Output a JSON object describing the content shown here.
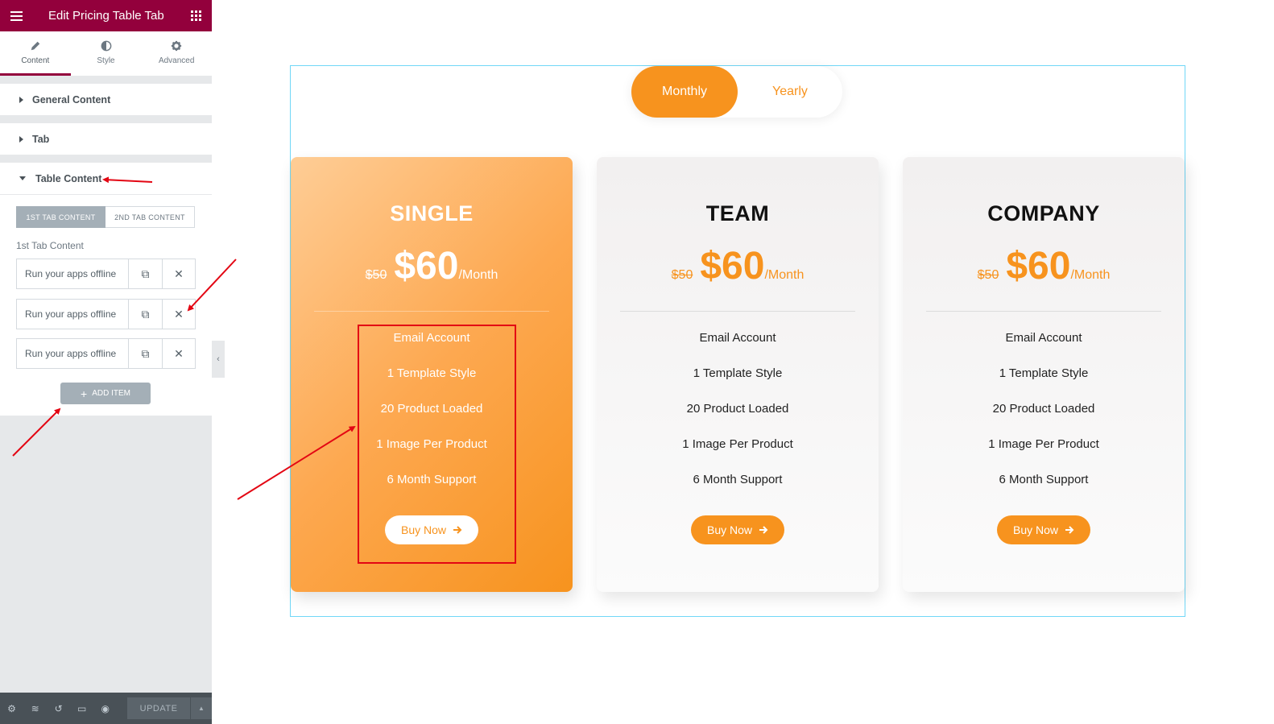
{
  "editor": {
    "title": "Edit Pricing Table Tab",
    "tabs": [
      {
        "label": "Content",
        "icon": "pencil-icon"
      },
      {
        "label": "Style",
        "icon": "half-circle-icon"
      },
      {
        "label": "Advanced",
        "icon": "gear-icon"
      }
    ],
    "sections": {
      "general": "General Content",
      "tab": "Tab",
      "table_content": "Table Content"
    },
    "content_tabs": {
      "first": "1ST TAB CONTENT",
      "second": "2ND TAB CONTENT"
    },
    "first_tab_label": "1st Tab Content",
    "items": [
      {
        "title": "Run your apps offline"
      },
      {
        "title": "Run your apps offline"
      },
      {
        "title": "Run your apps offline"
      }
    ],
    "add_item": "ADD ITEM",
    "footer": {
      "update": "UPDATE"
    }
  },
  "pricing": {
    "toggle": {
      "monthly": "Monthly",
      "yearly": "Yearly",
      "active": "Monthly"
    },
    "plans": [
      {
        "name": "SINGLE",
        "old_price": "$50",
        "price": "$60",
        "period": "/Month",
        "features": [
          "Email Account",
          "1 Template Style",
          "20 Product Loaded",
          "1 Image Per Product",
          "6 Month Support"
        ],
        "button": "Buy Now"
      },
      {
        "name": "TEAM",
        "old_price": "$50",
        "price": "$60",
        "period": "/Month",
        "features": [
          "Email Account",
          "1 Template Style",
          "20 Product Loaded",
          "1 Image Per Product",
          "6 Month Support"
        ],
        "button": "Buy Now"
      },
      {
        "name": "COMPANY",
        "old_price": "$50",
        "price": "$60",
        "period": "/Month",
        "features": [
          "Email Account",
          "1 Template Style",
          "20 Product Loaded",
          "1 Image Per Product",
          "6 Month Support"
        ],
        "button": "Buy Now"
      }
    ]
  },
  "colors": {
    "header": "#93003c",
    "accent": "#f7931e",
    "annotation": "#e30613",
    "frame": "#71d7f7"
  }
}
